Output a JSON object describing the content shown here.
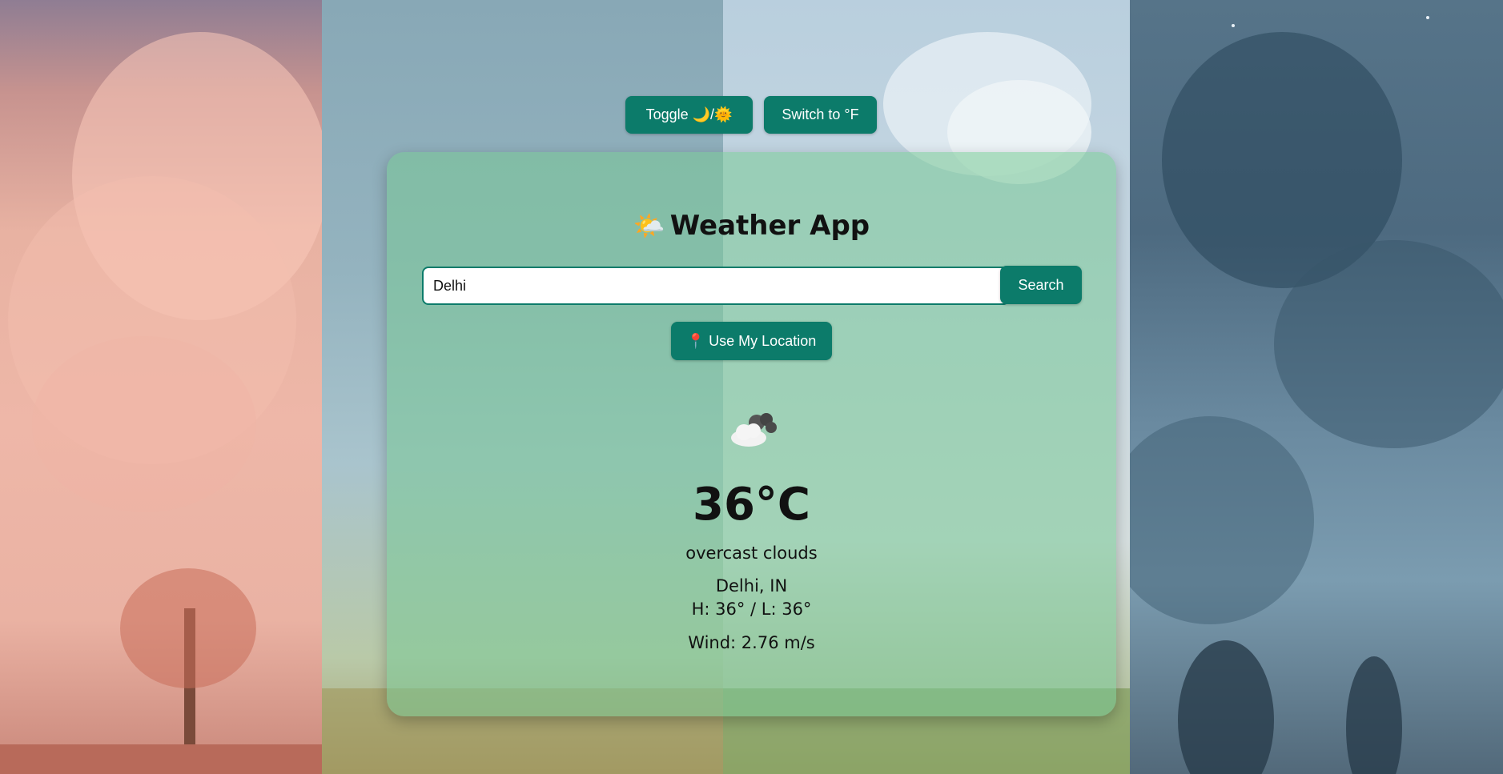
{
  "toolbar": {
    "theme_toggle_label": "Toggle 🌙/🌞",
    "unit_toggle_label": "Switch to °F"
  },
  "app": {
    "title_emoji": "🌤️",
    "title": "Weather App"
  },
  "search": {
    "value": "Delhi",
    "button_label": "Search"
  },
  "location_button_label": "📍 Use My Location",
  "weather": {
    "icon": "overcast-clouds-icon",
    "temperature": "36°C",
    "description": "overcast clouds",
    "location": "Delhi, IN",
    "high_low": "H: 36° / L: 36°",
    "wind": "Wind: 2.76 m/s"
  },
  "colors": {
    "accent": "#0c7b6a",
    "card_tint": "#78c896"
  }
}
